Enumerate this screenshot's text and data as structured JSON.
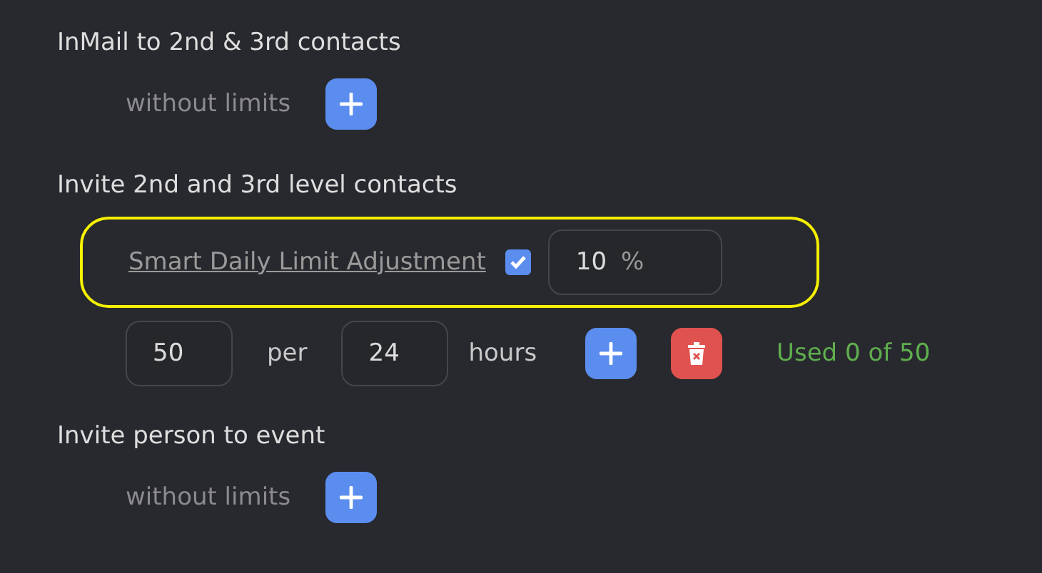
{
  "sections": [
    {
      "title": "InMail to 2nd & 3rd contacts",
      "kind": "unlimited",
      "note": "without limits"
    },
    {
      "title": "Invite 2nd and 3rd level contacts",
      "kind": "limited",
      "smart": {
        "label": "Smart Daily Limit Adjustment",
        "checked": true,
        "value": "10",
        "unit": "%",
        "highlighted": true
      },
      "count": "50",
      "per": "per",
      "period": "24",
      "period_unit": "hours",
      "used": "Used 0 of 50"
    },
    {
      "title": "Invite person to event",
      "kind": "unlimited",
      "note": "without limits"
    }
  ]
}
